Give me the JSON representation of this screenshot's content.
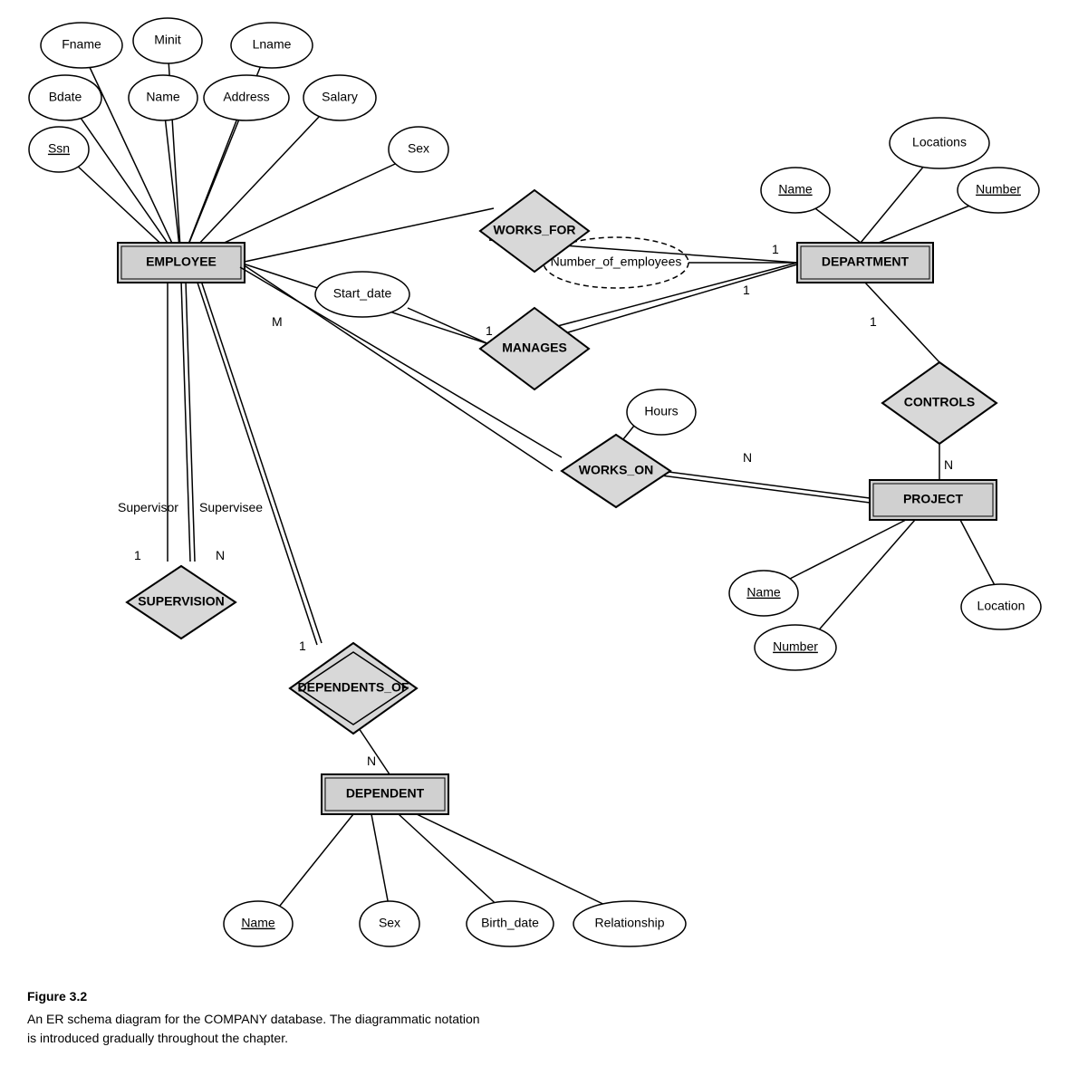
{
  "caption": {
    "title": "Figure 3.2",
    "line1": "An ER schema diagram for the COMPANY database. The diagrammatic notation",
    "line2": "is introduced gradually throughout the chapter."
  },
  "entities": {
    "employee": "EMPLOYEE",
    "department": "DEPARTMENT",
    "project": "PROJECT",
    "dependent": "DEPENDENT"
  },
  "relationships": {
    "works_for": "WORKS_FOR",
    "manages": "MANAGES",
    "works_on": "WORKS_ON",
    "controls": "CONTROLS",
    "supervision": "SUPERVISION",
    "dependents_of": "DEPENDENTS_OF"
  },
  "attributes": {
    "fname": "Fname",
    "minit": "Minit",
    "lname": "Lname",
    "bdate": "Bdate",
    "name_emp": "Name",
    "address": "Address",
    "salary": "Salary",
    "ssn": "Ssn",
    "sex_emp": "Sex",
    "start_date": "Start_date",
    "num_employees": "Number_of_employees",
    "locations": "Locations",
    "dept_name": "Name",
    "dept_number": "Number",
    "hours": "Hours",
    "proj_name": "Name",
    "proj_number": "Number",
    "location": "Location",
    "dep_name": "Name",
    "dep_sex": "Sex",
    "birth_date": "Birth_date",
    "relationship": "Relationship"
  }
}
